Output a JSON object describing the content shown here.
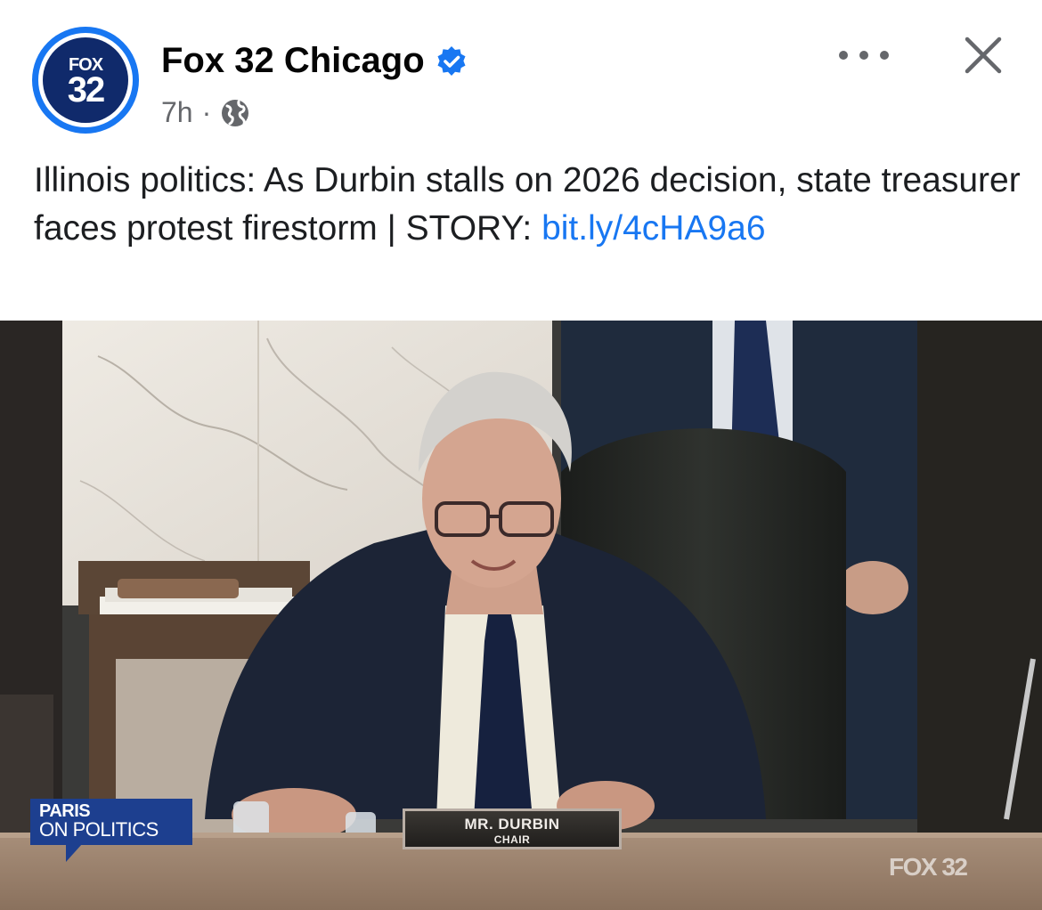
{
  "header": {
    "page_name": "Fox 32 Chicago",
    "timestamp": "7h",
    "separator": "·",
    "avatar_text_top": "FOX",
    "avatar_text_bottom": "32"
  },
  "post": {
    "text": "Illinois politics: As Durbin stalls on 2026 decision, state treasurer faces protest firestorm | STORY: ",
    "link_text": "bit.ly/4cHA9a6"
  },
  "image": {
    "bug_line1": "PARIS",
    "bug_line2": "ON POLITICS",
    "nameplate_name": "MR. DURBIN",
    "nameplate_title": "CHAIR",
    "watermark": "FOX 32"
  },
  "icons": {
    "verified": "verified-badge-icon",
    "audience": "globe-icon",
    "more": "more-options-icon",
    "close": "close-icon"
  },
  "colors": {
    "accent": "#1877f2",
    "text": "#1c1e21",
    "secondary_text": "#65676b",
    "avatar_core": "#102a6b"
  }
}
